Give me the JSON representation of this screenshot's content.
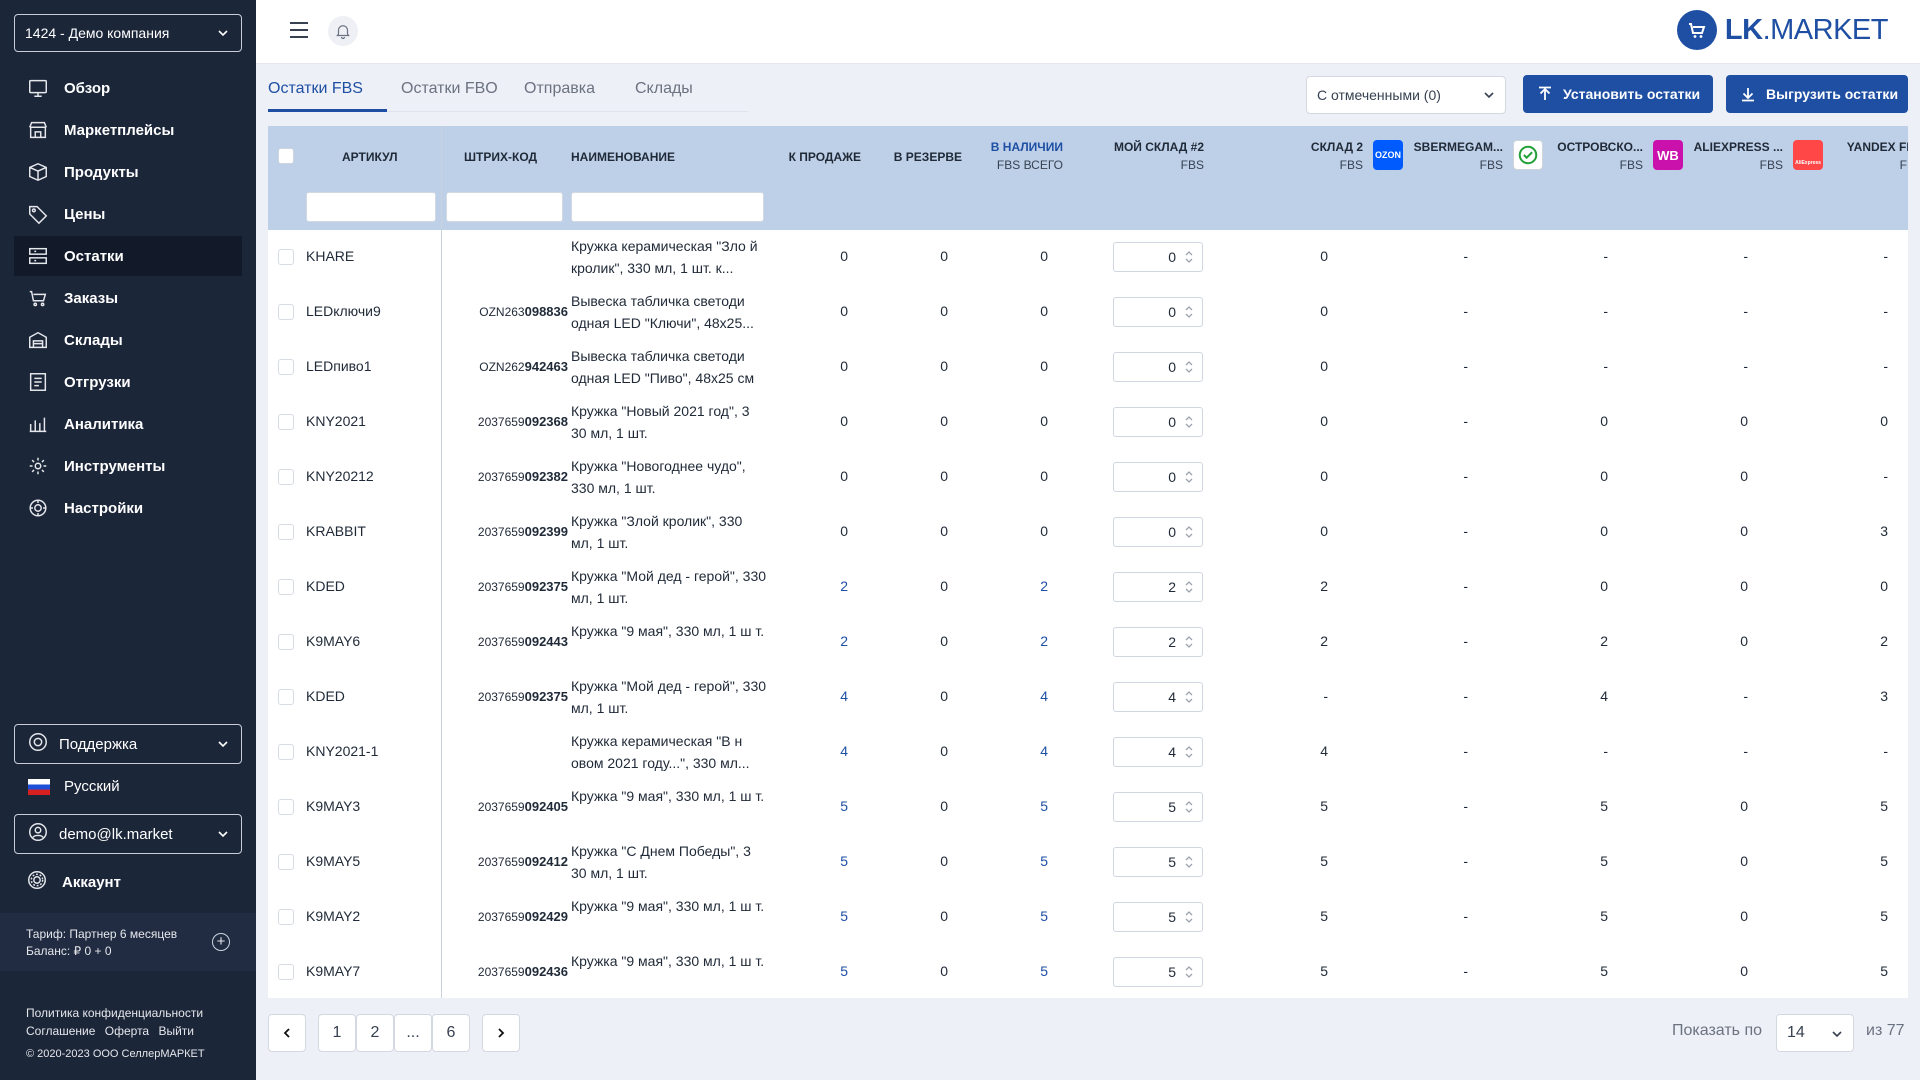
{
  "sidebar": {
    "company": "1424 - Демо компания",
    "nav": [
      {
        "label": "Обзор",
        "icon": "monitor-icon",
        "active": false
      },
      {
        "label": "Маркетплейсы",
        "icon": "store-icon",
        "active": false
      },
      {
        "label": "Продукты",
        "icon": "box-icon",
        "active": false
      },
      {
        "label": "Цены",
        "icon": "tag-icon",
        "active": false
      },
      {
        "label": "Остатки",
        "icon": "stock-icon",
        "active": true
      },
      {
        "label": "Заказы",
        "icon": "cart-icon",
        "active": false
      },
      {
        "label": "Склады",
        "icon": "warehouse-icon",
        "active": false
      },
      {
        "label": "Отгрузки",
        "icon": "shipment-icon",
        "active": false
      },
      {
        "label": "Аналитика",
        "icon": "chart-icon",
        "active": false
      },
      {
        "label": "Инструменты",
        "icon": "tools-icon",
        "active": false
      },
      {
        "label": "Настройки",
        "icon": "gear-icon",
        "active": false
      }
    ],
    "support": "Поддержка",
    "language": "Русский",
    "user": "demo@lk.market",
    "account": "Аккаунт",
    "tariff": "Тариф: Партнер 6 месяцев",
    "balance": "Баланс: ₽ 0 + 0",
    "links": [
      "Политика конфиденциальности",
      "Соглашение",
      "Оферта",
      "Выйти"
    ],
    "copyright": "© 2020-2023 ООО СеллерМАРКЕТ"
  },
  "header": {
    "logo_text": "LK",
    "logo_suffix": ".MARKET"
  },
  "tabs": [
    "Остатки FBS",
    "Остатки FBO",
    "Отправка",
    "Склады"
  ],
  "toolbar": {
    "bulk_select": "С отмеченными (0)",
    "set_stock": "Установить остатки",
    "export_stock": "Выгрузить остатки"
  },
  "columns": {
    "article": "АРТИКУЛ",
    "barcode": "ШТРИХ-КОД",
    "name": "НАИМЕНОВАНИЕ",
    "for_sale": "К ПРОДАЖЕ",
    "reserved": "В РЕЗЕРВЕ",
    "in_stock": "В НАЛИЧИИ",
    "in_stock_sub": "FBS ВСЕГО",
    "my_wh": "МОЙ СКЛАД #2",
    "my_wh_sub": "FBS",
    "wh2": "СКЛАД 2",
    "wh2_sub": "FBS",
    "wh2_badge": "OZON",
    "smm": "SBERMEGAM...",
    "smm_sub": "FBS",
    "ostr": "ОСТРОВСКО...",
    "ostr_sub": "FBS",
    "ostr_badge": "WB",
    "ali": "ALIEXPRESS ...",
    "ali_sub": "FBS",
    "ali_badge": "AliExpress",
    "yandex": "YANDEX FBS",
    "yandex_sub": "FBS"
  },
  "rows": [
    {
      "article": "KHARE",
      "bar_pre": "",
      "bar_suf": "",
      "name": "Кружка керамическая \"Зло й кролик\", 330 мл, 1 шт. к...",
      "sale": "0",
      "reserve": "0",
      "stock": "0",
      "qty": "0",
      "wh2": "0",
      "smm": "-",
      "ostr": "-",
      "ali": "-",
      "ya": "-",
      "blue": false
    },
    {
      "article": "LEDключи9",
      "bar_pre": "OZN263",
      "bar_suf": "098836",
      "name": "Вывеска табличка светоди одная LED \"Ключи\", 48x25...",
      "sale": "0",
      "reserve": "0",
      "stock": "0",
      "qty": "0",
      "wh2": "0",
      "smm": "-",
      "ostr": "-",
      "ali": "-",
      "ya": "-",
      "blue": false
    },
    {
      "article": "LEDпиво1",
      "bar_pre": "OZN262",
      "bar_suf": "942463",
      "name": "Вывеска табличка светоди одная LED \"Пиво\", 48x25 см",
      "sale": "0",
      "reserve": "0",
      "stock": "0",
      "qty": "0",
      "wh2": "0",
      "smm": "-",
      "ostr": "-",
      "ali": "-",
      "ya": "-",
      "blue": false
    },
    {
      "article": "KNY2021",
      "bar_pre": "2037659",
      "bar_suf": "092368",
      "name": "Кружка \"Новый 2021 год\", 3 30 мл, 1 шт.",
      "sale": "0",
      "reserve": "0",
      "stock": "0",
      "qty": "0",
      "wh2": "0",
      "smm": "-",
      "ostr": "0",
      "ali": "0",
      "ya": "0",
      "blue": false
    },
    {
      "article": "KNY20212",
      "bar_pre": "2037659",
      "bar_suf": "092382",
      "name": "Кружка \"Новогоднее чудо\", 330 мл, 1 шт.",
      "sale": "0",
      "reserve": "0",
      "stock": "0",
      "qty": "0",
      "wh2": "0",
      "smm": "-",
      "ostr": "0",
      "ali": "0",
      "ya": "-",
      "blue": false
    },
    {
      "article": "KRABBIT",
      "bar_pre": "2037659",
      "bar_suf": "092399",
      "name": "Кружка \"Злой кролик\", 330 мл, 1 шт.",
      "sale": "0",
      "reserve": "0",
      "stock": "0",
      "qty": "0",
      "wh2": "0",
      "smm": "-",
      "ostr": "0",
      "ali": "0",
      "ya": "3",
      "blue": false
    },
    {
      "article": "KDED",
      "bar_pre": "2037659",
      "bar_suf": "092375",
      "name": "Кружка \"Мой дед - герой\", 330 мл, 1 шт.",
      "sale": "2",
      "reserve": "0",
      "stock": "2",
      "qty": "2",
      "wh2": "2",
      "smm": "-",
      "ostr": "0",
      "ali": "0",
      "ya": "0",
      "blue": true
    },
    {
      "article": "K9MAY6",
      "bar_pre": "2037659",
      "bar_suf": "092443",
      "name": "Кружка \"9 мая\", 330 мл, 1 ш т.",
      "sale": "2",
      "reserve": "0",
      "stock": "2",
      "qty": "2",
      "wh2": "2",
      "smm": "-",
      "ostr": "2",
      "ali": "0",
      "ya": "2",
      "blue": true
    },
    {
      "article": "KDED",
      "bar_pre": "2037659",
      "bar_suf": "092375",
      "name": "Кружка \"Мой дед - герой\", 330 мл, 1 шт.",
      "sale": "4",
      "reserve": "0",
      "stock": "4",
      "qty": "4",
      "wh2": "-",
      "smm": "-",
      "ostr": "4",
      "ali": "-",
      "ya": "3",
      "blue": true
    },
    {
      "article": "KNY2021-1",
      "bar_pre": "",
      "bar_suf": "",
      "name": "Кружка керамическая \"В н овом 2021 году...\", 330 мл...",
      "sale": "4",
      "reserve": "0",
      "stock": "4",
      "qty": "4",
      "wh2": "4",
      "smm": "-",
      "ostr": "-",
      "ali": "-",
      "ya": "-",
      "blue": true
    },
    {
      "article": "K9MAY3",
      "bar_pre": "2037659",
      "bar_suf": "092405",
      "name": "Кружка \"9 мая\", 330 мл, 1 ш т.",
      "sale": "5",
      "reserve": "0",
      "stock": "5",
      "qty": "5",
      "wh2": "5",
      "smm": "-",
      "ostr": "5",
      "ali": "0",
      "ya": "5",
      "blue": true
    },
    {
      "article": "K9MAY5",
      "bar_pre": "2037659",
      "bar_suf": "092412",
      "name": "Кружка \"С Днем Победы\", 3 30 мл, 1 шт.",
      "sale": "5",
      "reserve": "0",
      "stock": "5",
      "qty": "5",
      "wh2": "5",
      "smm": "-",
      "ostr": "5",
      "ali": "0",
      "ya": "5",
      "blue": true
    },
    {
      "article": "K9MAY2",
      "bar_pre": "2037659",
      "bar_suf": "092429",
      "name": "Кружка \"9 мая\", 330 мл, 1 ш т.",
      "sale": "5",
      "reserve": "0",
      "stock": "5",
      "qty": "5",
      "wh2": "5",
      "smm": "-",
      "ostr": "5",
      "ali": "0",
      "ya": "5",
      "blue": true
    },
    {
      "article": "K9MAY7",
      "bar_pre": "2037659",
      "bar_suf": "092436",
      "name": "Кружка \"9 мая\", 330 мл, 1 ш т.",
      "sale": "5",
      "reserve": "0",
      "stock": "5",
      "qty": "5",
      "wh2": "5",
      "smm": "-",
      "ostr": "5",
      "ali": "0",
      "ya": "5",
      "blue": true
    }
  ],
  "pagination": {
    "pages": [
      "1",
      "2",
      "...",
      "6"
    ],
    "show_by": "Показать по",
    "per_page": "14",
    "total": "из  77"
  },
  "colors": {
    "accent": "#1e4fa3",
    "sidebar": "#1c2639",
    "header_row": "#bed0e8",
    "ozon": "#005bff",
    "wb": "#cb11ab",
    "ali": "#ff4747",
    "yandex": "#ffcc00",
    "sber": "#21a038"
  }
}
